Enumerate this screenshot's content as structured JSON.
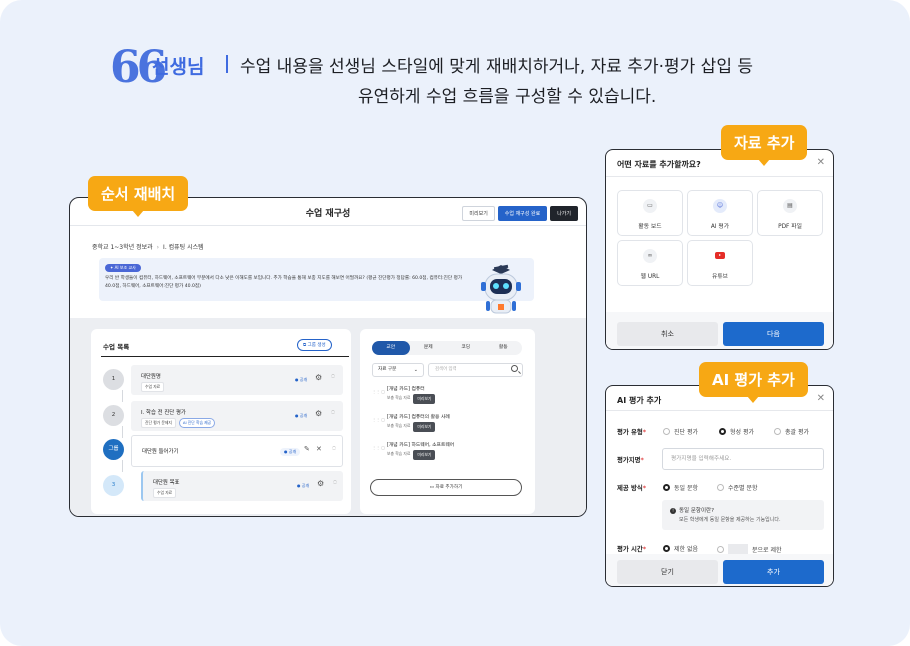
{
  "headline": {
    "quote_mark": "66",
    "speaker": "선생님",
    "line1": "수업 내용을 선생님 스타일에 맞게 재배치하거나, 자료 추가·평가 삽입 등",
    "line2": "유연하게 수업 흐름을 구성할 수 있습니다."
  },
  "tags": {
    "reorder": "순서 재배치",
    "add_material": "자료 추가",
    "add_eval": "AI 평가 추가"
  },
  "editor": {
    "title": "수업 재구성",
    "buttons": {
      "preview": "미리보기",
      "done": "수업 재구성 완료",
      "exit": "나가기"
    },
    "breadcrumb": {
      "course": "중학교 1~3학년 정보과",
      "unit": "I. 컴퓨팅 시스템"
    },
    "ai": {
      "badge": "AI 보조 교사",
      "text": "우리 반 학생들이 컴퓨터, 하드웨어, 소프트웨어 부분에서 다소 낮은 이해도를 보입니다. 추가 학습을 통해 보충 지도를 해보면 어떨까요? (평균 진단평가 정답률: 60.0점, 컴퓨터:진단 평가 40.0점, 하드웨어, 소프트웨어:진단 평가 40.0점)"
    },
    "list": {
      "title": "수업 목록",
      "group_button": "그룹 생성",
      "items": [
        {
          "badge": "1",
          "title": "대단원명",
          "tags": [
            "수업 자료"
          ],
          "status": "● 공개"
        },
        {
          "badge": "2",
          "title": "I. 학습 전 진단 평가",
          "tags": [
            "진단 평가 문제지"
          ],
          "ai_tag": "AI 진단 학습 제공",
          "status": "● 공개"
        },
        {
          "badge": "그룹",
          "title": "대단원 들어가기",
          "status": "● 공개"
        },
        {
          "badge": "3",
          "title": "대단원 목표",
          "tags": [
            "수업 자료"
          ],
          "status": "● 공개"
        }
      ]
    },
    "materials": {
      "tabs": [
        "교안",
        "문제",
        "코딩",
        "활동"
      ],
      "select": "자료 구분",
      "search_placeholder": "검색어 입력",
      "results": [
        {
          "title": "[개념 카드] 컴퓨터",
          "tag": "보충 학습 자료",
          "action": "미리보기"
        },
        {
          "title": "[개념 카드] 컴퓨터의 활용 사례",
          "tag": "보충 학습 자료",
          "action": "미리보기"
        },
        {
          "title": "[개념 카드] 하드웨어, 소프트웨어",
          "tag": "보충 학습 자료",
          "action": "미리보기"
        }
      ],
      "add_button": "자료 추가하기"
    }
  },
  "add_dialog": {
    "title": "어떤 자료를 추가할까요?",
    "options": [
      {
        "label": "활동 보드",
        "icon": "board-icon"
      },
      {
        "label": "AI 평가",
        "icon": "robot-icon"
      },
      {
        "label": "PDF 파일",
        "icon": "file-icon"
      },
      {
        "label": "웹 URL",
        "icon": "link-icon"
      },
      {
        "label": "유튜브",
        "icon": "youtube-icon"
      }
    ],
    "cancel": "취소",
    "next": "다음"
  },
  "eval_dialog": {
    "title": "AI 평가 추가",
    "type_label": "평가 유형",
    "type_options": [
      "진단 평가",
      "형성 평가",
      "총괄 평가"
    ],
    "name_label": "평가지명",
    "name_placeholder": "평가지명을 입력해주세요.",
    "method_label": "제공 방식",
    "method_options": [
      "동일 문항",
      "수준별 문항"
    ],
    "info_q": "동일 문항이란?",
    "info_a": "모든 학생에게 동일 문항을 제공하는 기능입니다.",
    "time_label": "평가 시간",
    "time_options": [
      "제한 없음",
      "분으로 제한"
    ],
    "close": "닫기",
    "add": "추가"
  }
}
